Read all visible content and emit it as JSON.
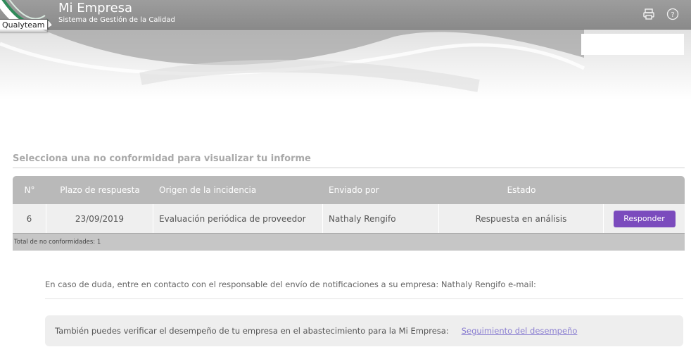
{
  "header": {
    "title": "Mi Empresa",
    "subtitle": "Sistema de Gestión de la Calidad",
    "tooltip": "Qualyteam",
    "icons": [
      "print-icon",
      "help-icon"
    ]
  },
  "section_title": "Selecciona una no conformidad para visualizar tu informe",
  "table": {
    "columns": [
      "N°",
      "Plazo de respuesta",
      "Origen de la incidencia",
      "Enviado por",
      "Estado",
      ""
    ],
    "rows": [
      {
        "num": "6",
        "plazo": "23/09/2019",
        "origen": "Evaluación periódica de proveedor",
        "enviado": "Nathaly Rengifo",
        "estado": "Respuesta en análisis",
        "action": "Responder"
      }
    ],
    "footer": "Total de no conformidades: 1"
  },
  "contact_note": "En caso de duda, entre en contacto con el responsable del envío de notificaciones a su empresa: Nathaly Rengifo e-mail:",
  "performance": {
    "text": "También puedes verificar el desempeño de tu empresa en el abastecimiento para la Mi Empresa:",
    "link": "Seguimiento del desempeño"
  },
  "colors": {
    "header_bg": "#929292",
    "button_purple": "#7b4bbd",
    "link": "#8b7fd1"
  }
}
